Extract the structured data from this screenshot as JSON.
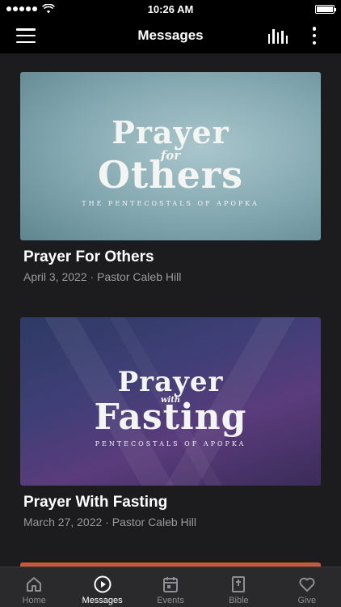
{
  "status": {
    "time": "10:26 AM"
  },
  "nav": {
    "title": "Messages"
  },
  "messages": [
    {
      "title": "Prayer For Others",
      "meta": "April 3, 2022 · Pastor Caleb Hill",
      "art": {
        "line1": "Prayer",
        "line2": "for",
        "line3": "Others",
        "sub": "THE PENTECOSTALS OF APOPKA"
      }
    },
    {
      "title": "Prayer With Fasting",
      "meta": "March 27, 2022 · Pastor Caleb Hill",
      "art": {
        "line1": "Prayer",
        "line2": "with",
        "line3": "Fasting",
        "sub": "PENTECOSTALS OF APOPKA"
      }
    }
  ],
  "tabs": [
    {
      "label": "Home",
      "icon": "home-icon",
      "active": false
    },
    {
      "label": "Messages",
      "icon": "play-icon",
      "active": true
    },
    {
      "label": "Events",
      "icon": "calendar-icon",
      "active": false
    },
    {
      "label": "Bible",
      "icon": "bible-icon",
      "active": false
    },
    {
      "label": "Give",
      "icon": "heart-icon",
      "active": false
    }
  ],
  "colors": {
    "background": "#1c1c1e",
    "bar": "#000000",
    "tab_inactive": "#8e8e93"
  }
}
